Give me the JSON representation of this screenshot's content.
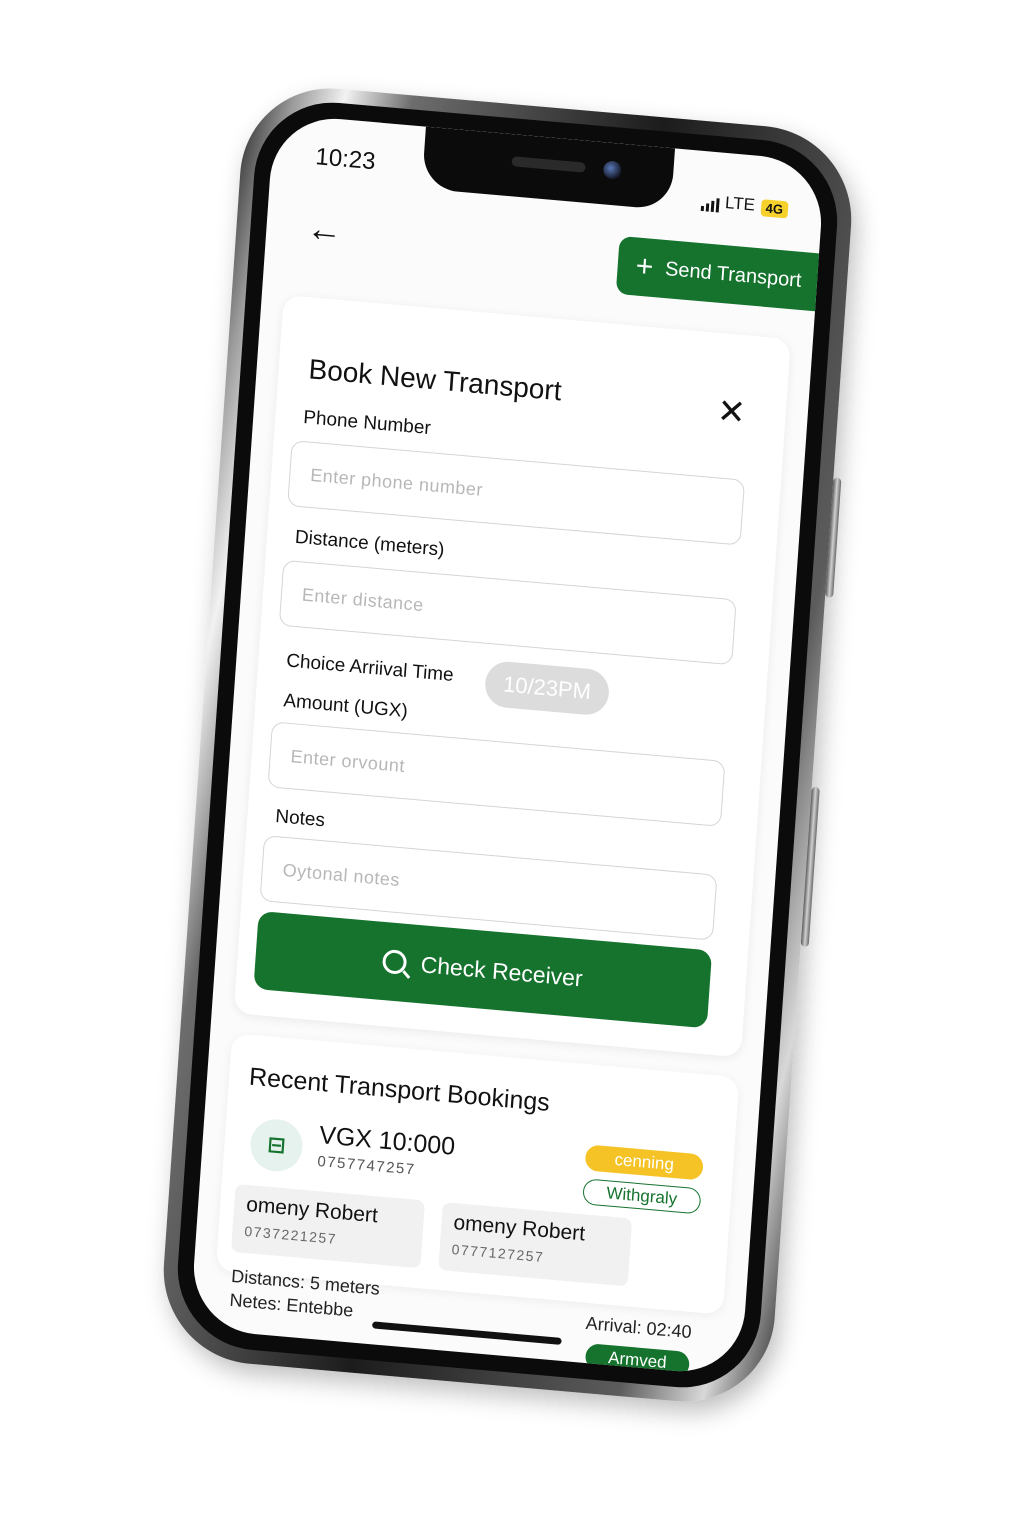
{
  "status_bar": {
    "time": "10:23",
    "network": "LTE",
    "badge": "4G"
  },
  "header": {
    "send_button_label": "Send Transport"
  },
  "booking_form": {
    "title": "Book New Transport",
    "phone_label": "Phone Number",
    "phone_placeholder": "Enter phone number",
    "distance_label": "Distance (meters)",
    "distance_placeholder": "Enter distance",
    "arrival_label": "Choice Arriival Time",
    "arrival_value": "10/23PM",
    "amount_label": "Amount (UGX)",
    "amount_placeholder": "Enter orvount",
    "notes_label": "Notes",
    "notes_placeholder": "Oytonal notes",
    "check_button_label": "Check Receiver"
  },
  "recent": {
    "title": "Recent Transport Bookings",
    "booking": {
      "amount": "VGX 10:000",
      "phone": "0757747257",
      "status_pending": "cenning",
      "status_type": "Withgraly",
      "sender": {
        "name": "omeny Robert",
        "phone": "0737221257"
      },
      "receiver": {
        "name": "omeny Robert",
        "phone": "0777127257"
      },
      "distance": "Distancs: 5 meters",
      "notes": "Netes: Entebbe",
      "arrival": "Arrival: 02:40",
      "status_arrived": "Armved"
    }
  },
  "colors": {
    "accent": "#15732e",
    "pending": "#f5c326",
    "field_border": "#d5d5d5"
  },
  "icons": [
    "back-arrow-icon",
    "plus-icon",
    "close-icon",
    "search-icon",
    "transport-icon",
    "signal-icon"
  ]
}
